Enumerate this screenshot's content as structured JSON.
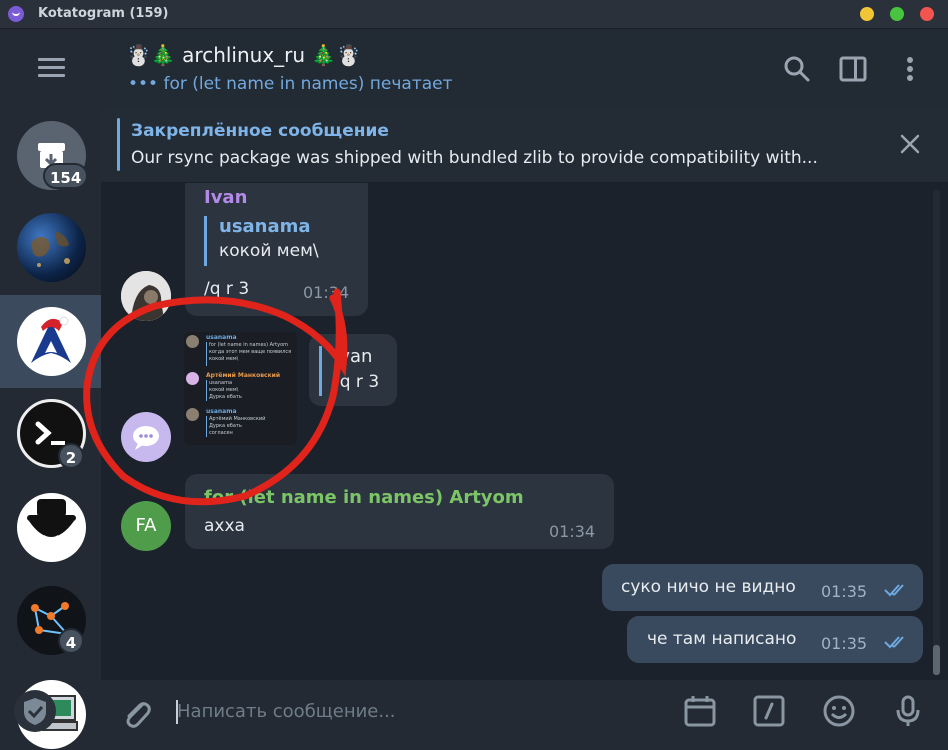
{
  "window": {
    "title": "Kotatogram (159)",
    "controls": {
      "minimize_color": "#f2c536",
      "maximize_color": "#47c53e",
      "close_color": "#f2544f"
    }
  },
  "sidebar": {
    "chats": [
      {
        "name": "archive",
        "badge": "154"
      },
      {
        "name": "earth-channel",
        "badge": ""
      },
      {
        "name": "archlinux_ru",
        "badge": "",
        "selected": true
      },
      {
        "name": "terminal-chat",
        "badge": "2"
      },
      {
        "name": "spy-chat",
        "badge": ""
      },
      {
        "name": "graph-chat",
        "badge": "4"
      },
      {
        "name": "computer-chat",
        "badge": ""
      }
    ]
  },
  "header": {
    "title": "☃️🎄 archlinux_ru 🎄☃️",
    "typing_dots": "•••",
    "typing_text": "for (let name in names) печатает",
    "icons": [
      "search-icon",
      "sidebar-toggle-icon",
      "more-vertical-icon"
    ]
  },
  "pinned": {
    "title": "Закреплённое сообщение",
    "text": "Our rsync package was shipped with bundled zlib to provide compatibility with..."
  },
  "messages": {
    "m1": {
      "sender": "Ivan",
      "quote_author": "usanama",
      "quote_text": "кокой мем\\",
      "text": "/q r 3",
      "time": "01:34",
      "sender_color": "#b48ae8"
    },
    "m2": {
      "reply_author": "Ivan",
      "reply_text": "/q r 3",
      "sticker": {
        "l1_name": "usanama",
        "l1_quote": "for (let name in names) Artyom",
        "l1_text1": "когда этот мем ваще появился",
        "l1_text2": "кокой мем\\",
        "l2_name": "Артёмий Манковский",
        "l2_quote": "usanama",
        "l2_text1": "кокой мем\\",
        "l2_text2": "Дурка ебать",
        "l3_name": "usanama",
        "l3_quote": "Артёмий Манковский",
        "l3_text1": "Дурка ебать",
        "l3_text2": "согласен"
      }
    },
    "m3": {
      "avatar_initials": "FA",
      "sender": "for (let name in names) Artyom",
      "text": "ахха",
      "time": "01:34",
      "sender_color": "#7cc567",
      "avatar_color": "#4f9d4a"
    },
    "m4": {
      "text": "суко ничо не видно",
      "time": "01:35"
    },
    "m5": {
      "text": "че там написано",
      "time": "01:35"
    }
  },
  "composer": {
    "placeholder": "Написать сообщение...",
    "icons": [
      "attach-icon",
      "schedule-icon",
      "bot-command-icon",
      "emoji-icon",
      "microphone-icon"
    ]
  },
  "annotation": {
    "circle_color": "#e0241b"
  }
}
